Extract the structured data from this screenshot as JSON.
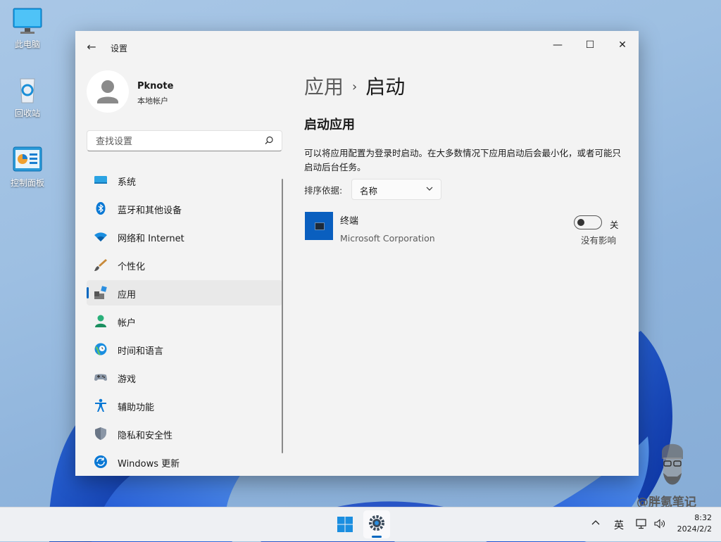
{
  "desktop": {
    "icons": [
      {
        "label": "此电脑"
      },
      {
        "label": "回收站"
      },
      {
        "label": "控制面板"
      }
    ]
  },
  "window": {
    "title": "设置",
    "controls": {
      "minimize": "—",
      "maximize": "☐",
      "close": "✕"
    },
    "back_icon": "←"
  },
  "profile": {
    "name": "Pknote",
    "account_type": "本地帐户"
  },
  "search": {
    "placeholder": "查找设置"
  },
  "nav": {
    "items": [
      {
        "label": "系统",
        "icon": "system-icon"
      },
      {
        "label": "蓝牙和其他设备",
        "icon": "bluetooth-icon"
      },
      {
        "label": "网络和 Internet",
        "icon": "wifi-icon"
      },
      {
        "label": "个性化",
        "icon": "brush-icon"
      },
      {
        "label": "应用",
        "icon": "apps-icon",
        "active": true
      },
      {
        "label": "帐户",
        "icon": "account-icon"
      },
      {
        "label": "时间和语言",
        "icon": "globe-clock-icon"
      },
      {
        "label": "游戏",
        "icon": "gamepad-icon"
      },
      {
        "label": "辅助功能",
        "icon": "accessibility-icon"
      },
      {
        "label": "隐私和安全性",
        "icon": "shield-icon"
      },
      {
        "label": "Windows 更新",
        "icon": "update-icon"
      }
    ]
  },
  "content": {
    "breadcrumb": {
      "parent": "应用",
      "separator": "›",
      "current": "启动"
    },
    "section_title": "启动应用",
    "description": "可以将应用配置为登录时启动。在大多数情况下应用启动后会最小化，或者可能只启动后台任务。",
    "sort": {
      "label": "排序依据:",
      "value": "名称"
    },
    "apps": [
      {
        "name": "终端",
        "publisher": "Microsoft Corporation",
        "toggle_state": "关",
        "enabled": false,
        "impact": "没有影响"
      }
    ]
  },
  "watermark": {
    "text": "@胖氪笔记"
  },
  "taskbar": {
    "ime": "英",
    "time": "8:32",
    "date": "2024/2/2"
  },
  "colors": {
    "accent": "#0067c0",
    "window_bg": "#f3f3f3",
    "app_tile": "#0a5fbf"
  }
}
